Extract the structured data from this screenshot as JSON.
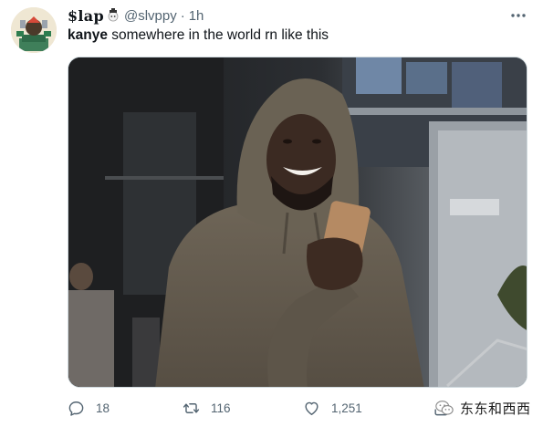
{
  "tweet": {
    "author": {
      "display_name": "$lap",
      "handle": "@slvppy",
      "separator": "·",
      "time": "1h"
    },
    "text": {
      "bold": "kanye",
      "rest": " somewhere in the world rn like this"
    },
    "media": {
      "icon": "photo"
    },
    "actions": {
      "replies": "18",
      "retweets": "116",
      "likes": "1,251"
    }
  },
  "watermark": {
    "text": "东东和西西"
  }
}
